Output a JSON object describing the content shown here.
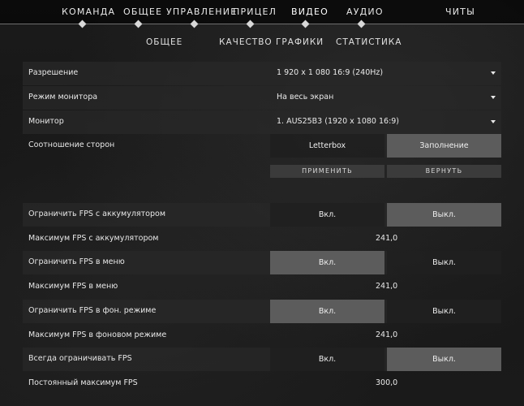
{
  "topnav": {
    "tabs": [
      {
        "label": "КОМАНДА"
      },
      {
        "label": "ОБЩЕЕ"
      },
      {
        "label": "УПРАВЛЕНИЕ"
      },
      {
        "label": "ПРИЦЕЛ"
      },
      {
        "label": "ВИДЕО"
      },
      {
        "label": "АУДИО"
      },
      {
        "label": "ЧИТЫ"
      }
    ],
    "active_tab": "ВИДЕО"
  },
  "subnav": {
    "tabs": [
      {
        "label": "ОБЩЕЕ"
      },
      {
        "label": "КАЧЕСТВО ГРАФИКИ"
      },
      {
        "label": "СТАТИСТИКА"
      }
    ]
  },
  "settings": {
    "resolution": {
      "label": "Разрешение",
      "value": "1 920 x 1 080 16:9 (240Hz)"
    },
    "monitor_mode": {
      "label": "Режим монитора",
      "value": "На весь экран"
    },
    "monitor": {
      "label": "Монитор",
      "value": "1. AUS25B3 (1920 x  1080 16:9)"
    },
    "aspect": {
      "label": "Соотношение сторон",
      "option_a": "Letterbox",
      "option_b": "Заполнение",
      "selected": "Заполнение"
    },
    "apply_label": "ПРИМЕНИТЬ",
    "revert_label": "ВЕРНУТЬ",
    "fps_battery_limit": {
      "label": "Ограничить FPS с аккумулятором",
      "on": "Вкл.",
      "off": "Выкл.",
      "selected": "Выкл."
    },
    "fps_battery_max": {
      "label": "Максимум FPS с аккумулятором",
      "value": "241,0"
    },
    "fps_menu_limit": {
      "label": "Ограничить FPS в меню",
      "on": "Вкл.",
      "off": "Выкл.",
      "selected": "Вкл."
    },
    "fps_menu_max": {
      "label": "Максимум FPS в меню",
      "value": "241,0"
    },
    "fps_bg_limit": {
      "label": "Ограничить FPS в фон. режиме",
      "on": "Вкл.",
      "off": "Выкл.",
      "selected": "Вкл."
    },
    "fps_bg_max": {
      "label": "Максимум FPS в фоновом режиме",
      "value": "241,0"
    },
    "fps_always_limit": {
      "label": "Всегда ограничивать FPS",
      "on": "Вкл.",
      "off": "Выкл.",
      "selected": "Выкл."
    },
    "fps_always_max": {
      "label": "Постоянный максимум FPS",
      "value": "300,0"
    }
  },
  "colors": {
    "selected_segment": "#5c5c5c",
    "background": "#141414"
  }
}
